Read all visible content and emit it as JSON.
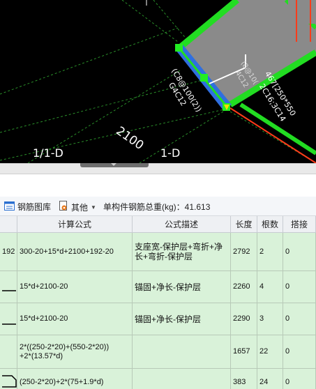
{
  "cad": {
    "label_2100": "2100",
    "axis_left": "1/1-D",
    "axis_right": "1-D",
    "ann_a": "(C8@100(2))",
    "ann_b": "G4C12",
    "ann_c": "467[250*550",
    "ann_d": "2C16;3C14",
    "ann_e": "(8@10(",
    "ann_f": "4C12",
    "colors": {
      "beam_edge": "#22dd22",
      "beam_fill": "#8a8a8a",
      "selected_beam": "#2f6fe0",
      "rebar_line": "#ff3b1a"
    }
  },
  "toolbar": {
    "library_label": "钢筋图库",
    "other_label": "其他",
    "total_weight": "单构件钢筋总重(kg)：41.613"
  },
  "grid": {
    "headers": [
      "计算公式",
      "公式描述",
      "长度",
      "根数",
      "搭接"
    ],
    "rows": [
      {
        "lead": "192",
        "formula": "300-20+15*d+2100+192-20",
        "desc": "支座宽-保护层+弯折+净\n长+弯折-保护层",
        "length": "2792",
        "count": "2",
        "lap": "0"
      },
      {
        "lead": "",
        "formula": "15*d+2100-20",
        "desc": "锚固+净长-保护层",
        "length": "2260",
        "count": "4",
        "lap": "0"
      },
      {
        "lead": "",
        "formula": "15*d+2100-20",
        "desc": "锚固+净长-保护层",
        "length": "2290",
        "count": "3",
        "lap": "0"
      },
      {
        "lead": "",
        "formula": "2*((250-2*20)+(550-2*20))\n+2*(13.57*d)",
        "desc": "",
        "length": "1657",
        "count": "22",
        "lap": "0"
      },
      {
        "lead": "",
        "formula": "(250-2*20)+2*(75+1.9*d)",
        "desc": "",
        "length": "383",
        "count": "24",
        "lap": "0"
      }
    ]
  }
}
